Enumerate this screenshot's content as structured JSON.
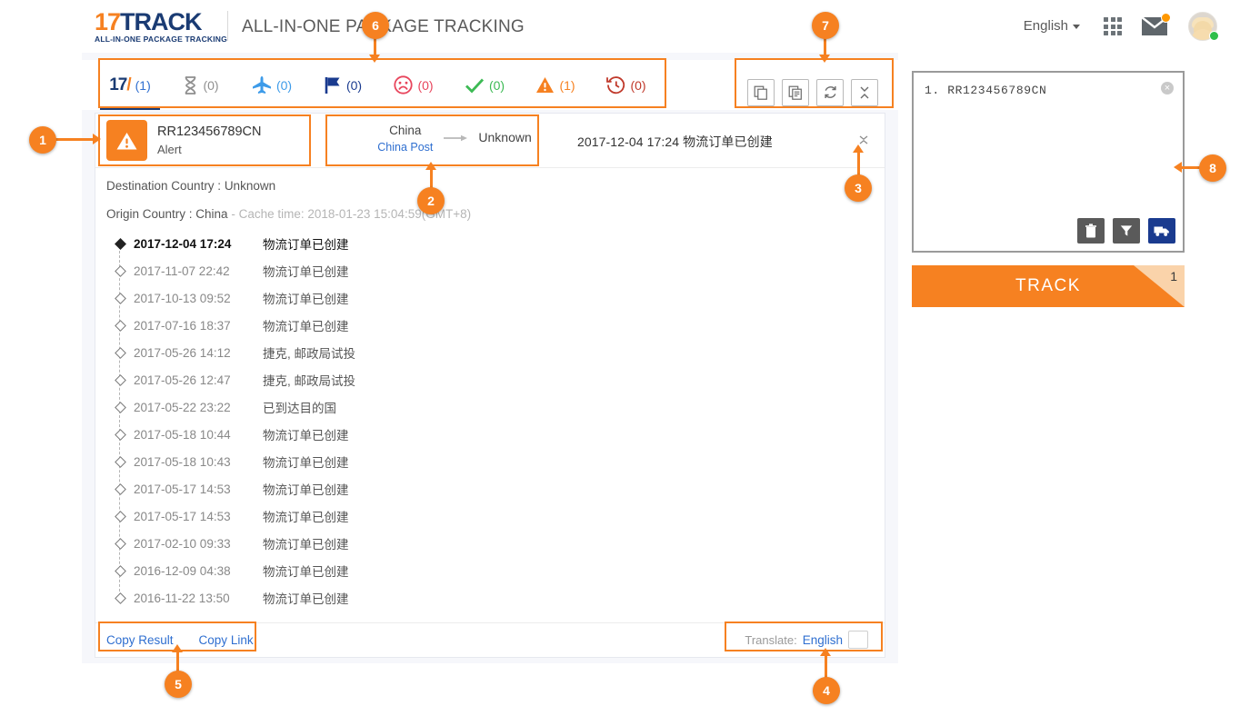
{
  "header": {
    "logo_main_prefix": "17",
    "logo_main_suffix": "TRACK",
    "logo_subtitle": "ALL-IN-ONE PACKAGE TRACKING",
    "title": "ALL-IN-ONE PACKAGE TRACKING",
    "language": "English",
    "apps_icon": "apps-grid-icon",
    "mail_icon": "mail-icon",
    "avatar_icon": "avatar"
  },
  "status_tabs": [
    {
      "key": "all",
      "icon": "17-logo-icon",
      "count": "(1)",
      "color": "#2f6fd0",
      "active": true
    },
    {
      "key": "not-found",
      "icon": "hourglass-icon",
      "count": "(0)",
      "color": "#8f8f8f",
      "active": false
    },
    {
      "key": "in-transit",
      "icon": "airplane-icon",
      "count": "(0)",
      "color": "#3d9be9",
      "active": false
    },
    {
      "key": "pickup",
      "icon": "flag-icon",
      "count": "(0)",
      "color": "#1a3b8f",
      "active": false
    },
    {
      "key": "undelivered",
      "icon": "sad-face-icon",
      "count": "(0)",
      "color": "#e8455c",
      "active": false
    },
    {
      "key": "delivered",
      "icon": "check-icon",
      "count": "(0)",
      "color": "#3cba54",
      "active": false
    },
    {
      "key": "alert",
      "icon": "warning-icon",
      "count": "(1)",
      "color": "#f68121",
      "active": false
    },
    {
      "key": "expired",
      "icon": "clock-back-icon",
      "count": "(0)",
      "color": "#c0392b",
      "active": false
    }
  ],
  "toolbar_buttons": [
    {
      "name": "copy-single-icon",
      "icon": "copy-icon"
    },
    {
      "name": "copy-all-icon",
      "icon": "copy-list-icon"
    },
    {
      "name": "refresh-icon",
      "icon": "refresh-icon"
    },
    {
      "name": "collapse-all-icon",
      "icon": "collapse-icon"
    }
  ],
  "result": {
    "package_icon": "alert-triangle-icon",
    "tracking_number": "RR123456789CN",
    "status": "Alert",
    "origin_country": "China",
    "origin_carrier": "China Post",
    "destination_country": "Unknown",
    "latest_event": "2017-12-04 17:24  物流订单已创建",
    "destination_line_label": "Destination Country : ",
    "destination_line_value": "Unknown",
    "origin_line_label": "Origin Country : ",
    "origin_line_value": "China",
    "cache_time": " - Cache time: 2018-01-23 15:04:59(GMT+8)",
    "events": [
      {
        "time": "2017-12-04 17:24",
        "desc": "物流订单已创建",
        "current": true
      },
      {
        "time": "2017-11-07 22:42",
        "desc": "物流订单已创建",
        "current": false
      },
      {
        "time": "2017-10-13 09:52",
        "desc": "物流订单已创建",
        "current": false
      },
      {
        "time": "2017-07-16 18:37",
        "desc": "物流订单已创建",
        "current": false
      },
      {
        "time": "2017-05-26 14:12",
        "desc": "捷克, 邮政局试投",
        "current": false
      },
      {
        "time": "2017-05-26 12:47",
        "desc": "捷克, 邮政局试投",
        "current": false
      },
      {
        "time": "2017-05-22 23:22",
        "desc": "已到达目的国",
        "current": false
      },
      {
        "time": "2017-05-18 10:44",
        "desc": "物流订单已创建",
        "current": false
      },
      {
        "time": "2017-05-18 10:43",
        "desc": "物流订单已创建",
        "current": false
      },
      {
        "time": "2017-05-17 14:53",
        "desc": "物流订单已创建",
        "current": false
      },
      {
        "time": "2017-05-17 14:53",
        "desc": "物流订单已创建",
        "current": false
      },
      {
        "time": "2017-02-10 09:33",
        "desc": "物流订单已创建",
        "current": false
      },
      {
        "time": "2016-12-09 04:38",
        "desc": "物流订单已创建",
        "current": false
      },
      {
        "time": "2016-11-22 13:50",
        "desc": "物流订单已创建",
        "current": false
      }
    ],
    "copy_result_label": "Copy Result",
    "copy_link_label": "Copy Link",
    "translate_label": "Translate:",
    "translate_value": "English"
  },
  "side": {
    "textarea_value": "1. RR123456789CN",
    "clear_icon": "clear-circle-icon",
    "delete_icon": "trash-icon",
    "filter_icon": "filter-icon",
    "carrier_icon": "truck-icon",
    "track_button_label": "TRACK",
    "track_count": "1"
  },
  "annotations": [
    {
      "n": "1",
      "target": "package-status-block"
    },
    {
      "n": "2",
      "target": "route-block"
    },
    {
      "n": "3",
      "target": "collapse-toggle"
    },
    {
      "n": "4",
      "target": "translate-block"
    },
    {
      "n": "5",
      "target": "copy-buttons-block"
    },
    {
      "n": "6",
      "target": "status-tabs-block"
    },
    {
      "n": "7",
      "target": "toolbar-block"
    },
    {
      "n": "8",
      "target": "tracking-input-block"
    }
  ],
  "colors": {
    "brand_orange": "#f68121",
    "brand_blue": "#1a3b73",
    "link_blue": "#2f6fd0",
    "panel_bg": "#f6f7fb"
  }
}
